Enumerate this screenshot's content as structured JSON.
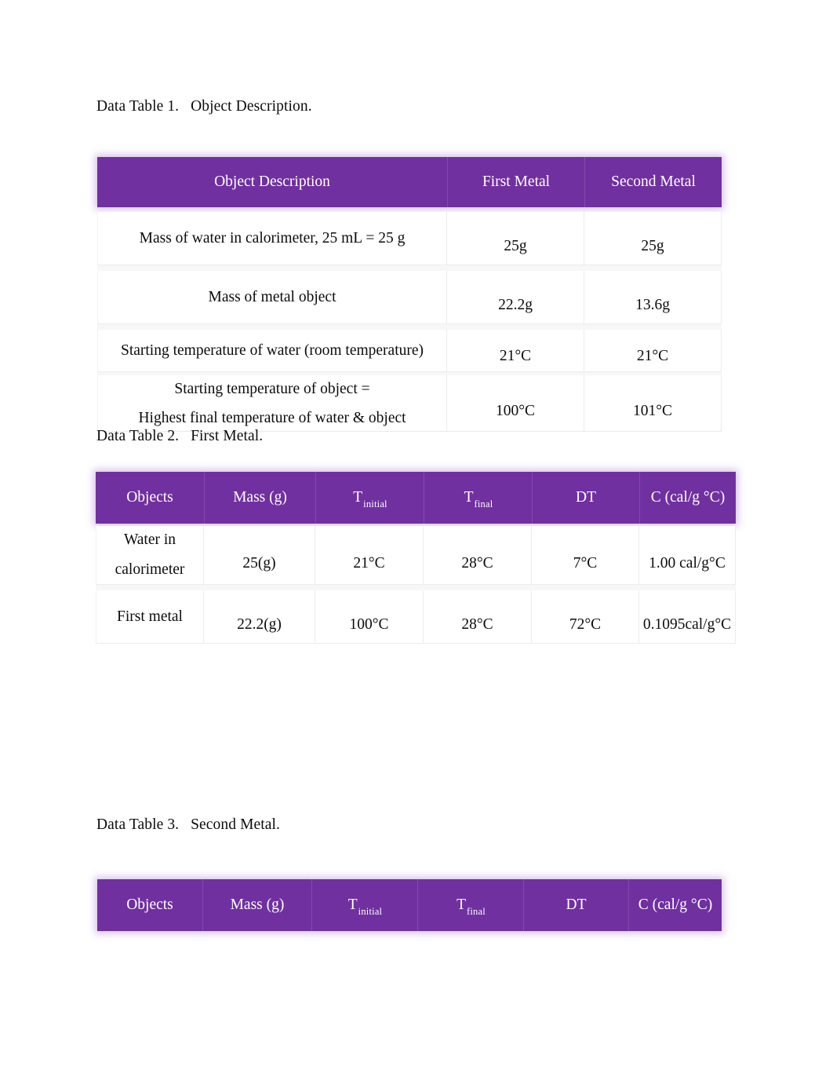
{
  "document": {
    "captions": {
      "table1": "Data Table 1.   Object Description.",
      "table2": "Data Table 2.   First Metal.",
      "table3": "Data Table 3.   Second Metal."
    },
    "accent_color": "#7030A0",
    "header_text_color": "#FFFFFF",
    "body_text_color": "#0C0C0C"
  },
  "table1": {
    "headers": [
      "Object Description",
      "First Metal",
      "Second Metal"
    ],
    "rows": [
      {
        "label": "Mass of water in calorimeter, 25 mL = 25 g",
        "label_line2": "",
        "first_metal": "25g",
        "second_metal": "25g"
      },
      {
        "label": "Mass of metal object",
        "label_line2": "",
        "first_metal": "22.2g",
        "second_metal": "13.6g"
      },
      {
        "label": "Starting temperature of water (room temperature)",
        "label_line2": "",
        "first_metal": "21°C",
        "second_metal": "21°C"
      },
      {
        "label": "Starting temperature of object =",
        "label_line2": "Highest final temperature of water & object",
        "first_metal": "100°C",
        "second_metal": "101°C"
      }
    ]
  },
  "table2": {
    "headers": [
      {
        "text": "Objects",
        "sub": ""
      },
      {
        "text": "Mass (g)",
        "sub": ""
      },
      {
        "text": "T",
        "sub": "initial"
      },
      {
        "text": "T",
        "sub": "final"
      },
      {
        "text": "DT",
        "sub": ""
      },
      {
        "text": "C (cal/g °C)",
        "sub": ""
      }
    ],
    "rows": [
      {
        "object_line1": "Water in",
        "object_line2": "calorimeter",
        "mass": "25(g)",
        "t_initial": "21°C",
        "t_final": "28°C",
        "dt": "7°C",
        "c": "1.00 cal/g°C"
      },
      {
        "object_line1": "First metal",
        "object_line2": "",
        "mass": "22.2(g)",
        "t_initial": "100°C",
        "t_final": "28°C",
        "dt": "72°C",
        "c": "0.1095cal/g°C"
      }
    ]
  },
  "table3": {
    "headers": [
      {
        "text": "Objects",
        "sub": ""
      },
      {
        "text": "Mass (g)",
        "sub": ""
      },
      {
        "text": "T",
        "sub": "initial"
      },
      {
        "text": "T",
        "sub": "final"
      },
      {
        "text": "DT",
        "sub": ""
      },
      {
        "text": "C (cal/g °C)",
        "sub": ""
      }
    ],
    "rows": []
  }
}
